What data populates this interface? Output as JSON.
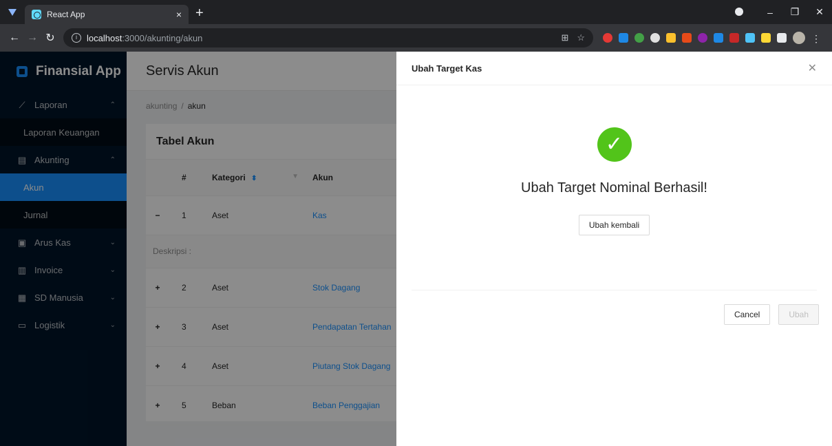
{
  "browser": {
    "tab_title": "React App",
    "tab_close": "×",
    "new_tab": "+",
    "url_host": "localhost",
    "url_path": ":3000/akunting/akun"
  },
  "sidebar": {
    "app_name": "Finansial App",
    "items": [
      {
        "label": "Laporan",
        "icon": "chart-line-icon",
        "arrow": "^"
      },
      {
        "label": "Laporan Keuangan"
      },
      {
        "label": "Akunting",
        "icon": "bank-icon",
        "arrow": "^"
      },
      {
        "label": "Akun"
      },
      {
        "label": "Jurnal"
      },
      {
        "label": "Arus Kas",
        "icon": "cash-icon",
        "arrow": "v"
      },
      {
        "label": "Invoice",
        "icon": "invoice-icon",
        "arrow": "v"
      },
      {
        "label": "SD Manusia",
        "icon": "team-icon",
        "arrow": "v"
      },
      {
        "label": "Logistik",
        "icon": "box-icon",
        "arrow": "v"
      }
    ]
  },
  "header": {
    "title": "Servis Akun"
  },
  "breadcrumb": {
    "parent": "akunting",
    "separator": "/",
    "current": "akun"
  },
  "card": {
    "title": "Tabel Akun"
  },
  "table": {
    "headers": [
      "#",
      "Kategori",
      "Akun"
    ],
    "rows": [
      {
        "expand": "−",
        "no": "1",
        "kategori": "Aset",
        "akun": "Kas"
      },
      {
        "expand": "+",
        "no": "2",
        "kategori": "Aset",
        "akun": "Stok Dagang"
      },
      {
        "expand": "+",
        "no": "3",
        "kategori": "Aset",
        "akun": "Pendapatan Tertahan"
      },
      {
        "expand": "+",
        "no": "4",
        "kategori": "Aset",
        "akun": "Piutang Stok Dagang"
      },
      {
        "expand": "+",
        "no": "5",
        "kategori": "Beban",
        "akun": "Beban Penggajian"
      }
    ],
    "description_label": "Deskripsi :"
  },
  "drawer": {
    "title": "Ubah Target Kas",
    "result_title": "Ubah Target Nominal Berhasil!",
    "result_button": "Ubah kembali",
    "cancel": "Cancel",
    "submit": "Ubah"
  },
  "colors": {
    "primary": "#1890ff",
    "success": "#52c41a",
    "sidebar": "#001529"
  }
}
